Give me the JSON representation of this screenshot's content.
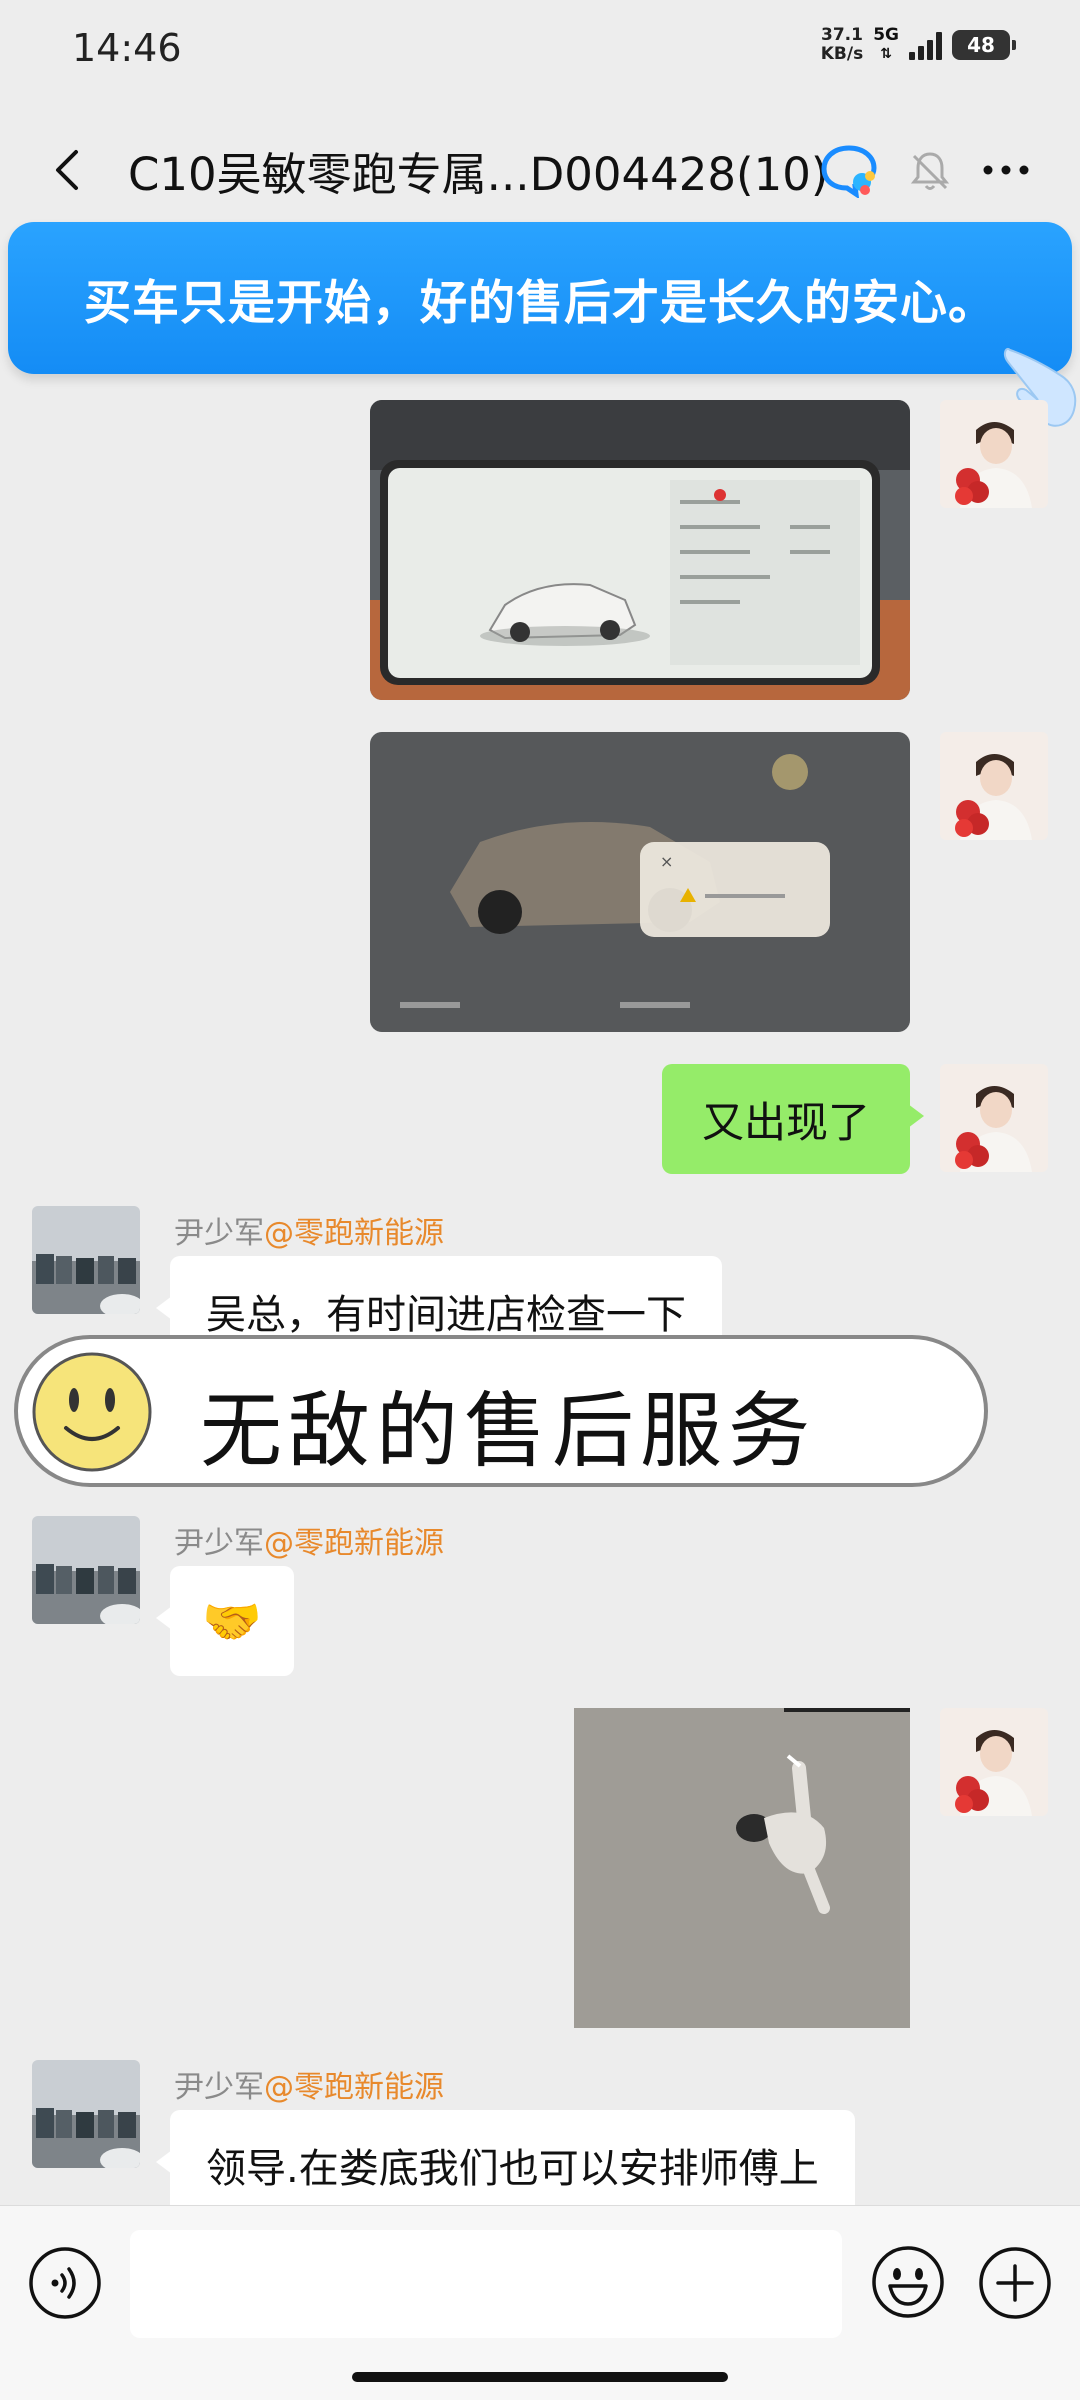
{
  "status": {
    "time": "14:46",
    "speed_value": "37.1",
    "speed_unit": "KB/s",
    "network": "5G",
    "battery": "48"
  },
  "header": {
    "title": "C10吴敏零跑专属...D004428(10)",
    "icons": [
      "back-icon",
      "qq-team-icon",
      "mute-bell-icon",
      "more-icon"
    ]
  },
  "banner": {
    "text": "买车只是开始，好的售后才是长久的安心。"
  },
  "messages": [
    {
      "side": "me",
      "type": "image",
      "content": "car-dashboard-photo"
    },
    {
      "side": "me",
      "type": "image",
      "content": "car-warning-photo"
    },
    {
      "side": "me",
      "type": "text",
      "text": "又出现了"
    },
    {
      "side": "them",
      "type": "text",
      "sender_name": "尹少军",
      "sender_tag": "@零跑新能源",
      "text": "吴总，有时间进店检查一下"
    },
    {
      "side": "them",
      "type": "emoji",
      "sender_name": "尹少军",
      "sender_tag": "@零跑新能源",
      "text": "🤝"
    },
    {
      "side": "me",
      "type": "image",
      "content": "person-lying-on-ground-photo"
    },
    {
      "side": "them",
      "type": "text",
      "sender_name": "尹少军",
      "sender_tag": "@零跑新能源",
      "text": "领导.在娄底我们也可以安排师傅上"
    }
  ],
  "overlay": {
    "text": "无敌的售后服务"
  },
  "input": {
    "placeholder": ""
  },
  "colors": {
    "banner": "#1a93f8",
    "my_bubble": "#95ec69",
    "sender_tag": "#e8892c",
    "background": "#ededed"
  }
}
